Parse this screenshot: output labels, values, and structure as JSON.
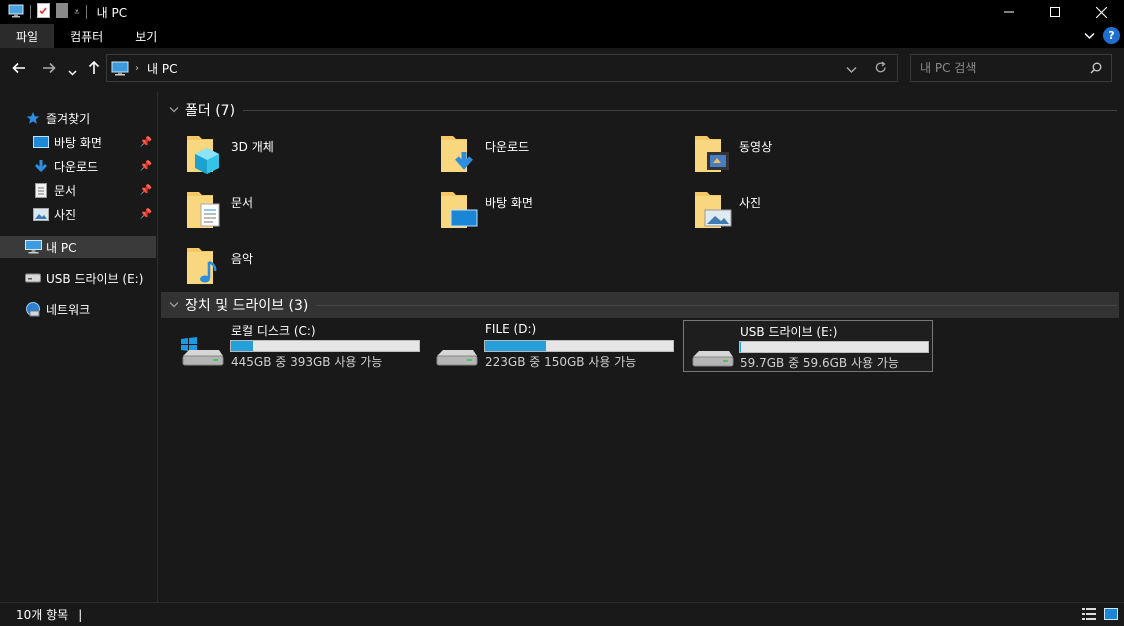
{
  "window": {
    "title": "내 PC"
  },
  "ribbon": {
    "tabs": [
      "파일",
      "컴퓨터",
      "보기"
    ]
  },
  "address": {
    "path": "내 PC"
  },
  "search": {
    "placeholder": "내 PC 검색"
  },
  "sidebar": {
    "quick_access": "즐겨찾기",
    "items": [
      {
        "label": "바탕 화면",
        "icon": "desktop-icon",
        "pinned": true
      },
      {
        "label": "다운로드",
        "icon": "download-icon",
        "pinned": true
      },
      {
        "label": "문서",
        "icon": "document-icon",
        "pinned": true
      },
      {
        "label": "사진",
        "icon": "picture-icon",
        "pinned": true
      }
    ],
    "this_pc": "내 PC",
    "usb": "USB 드라이브 (E:)",
    "network": "네트워크"
  },
  "groups": {
    "folders_title": "폴더 (7)",
    "devices_title": "장치 및 드라이브 (3)"
  },
  "folders": [
    {
      "name": "3D 개체",
      "icon": "3d-objects-icon"
    },
    {
      "name": "다운로드",
      "icon": "download-icon"
    },
    {
      "name": "동영상",
      "icon": "video-icon"
    },
    {
      "name": "문서",
      "icon": "document-icon"
    },
    {
      "name": "바탕 화면",
      "icon": "desktop-icon"
    },
    {
      "name": "사진",
      "icon": "picture-icon"
    },
    {
      "name": "음악",
      "icon": "music-icon"
    }
  ],
  "drives": [
    {
      "name": "로컬 디스크 (C:)",
      "info": "445GB 중 393GB 사용 가능",
      "used_fraction": 0.117,
      "windows": true
    },
    {
      "name": "FILE (D:)",
      "info": "223GB 중 150GB 사용 가능",
      "used_fraction": 0.327,
      "windows": false
    },
    {
      "name": "USB 드라이브 (E:)",
      "info": "59.7GB 중 59.6GB 사용 가능",
      "used_fraction": 0.002,
      "windows": false,
      "selected": true
    }
  ],
  "status": {
    "item_count": "10개 항목"
  },
  "colors": {
    "accent": "#26a0da",
    "background": "#191919",
    "folder": "#f5c867"
  }
}
